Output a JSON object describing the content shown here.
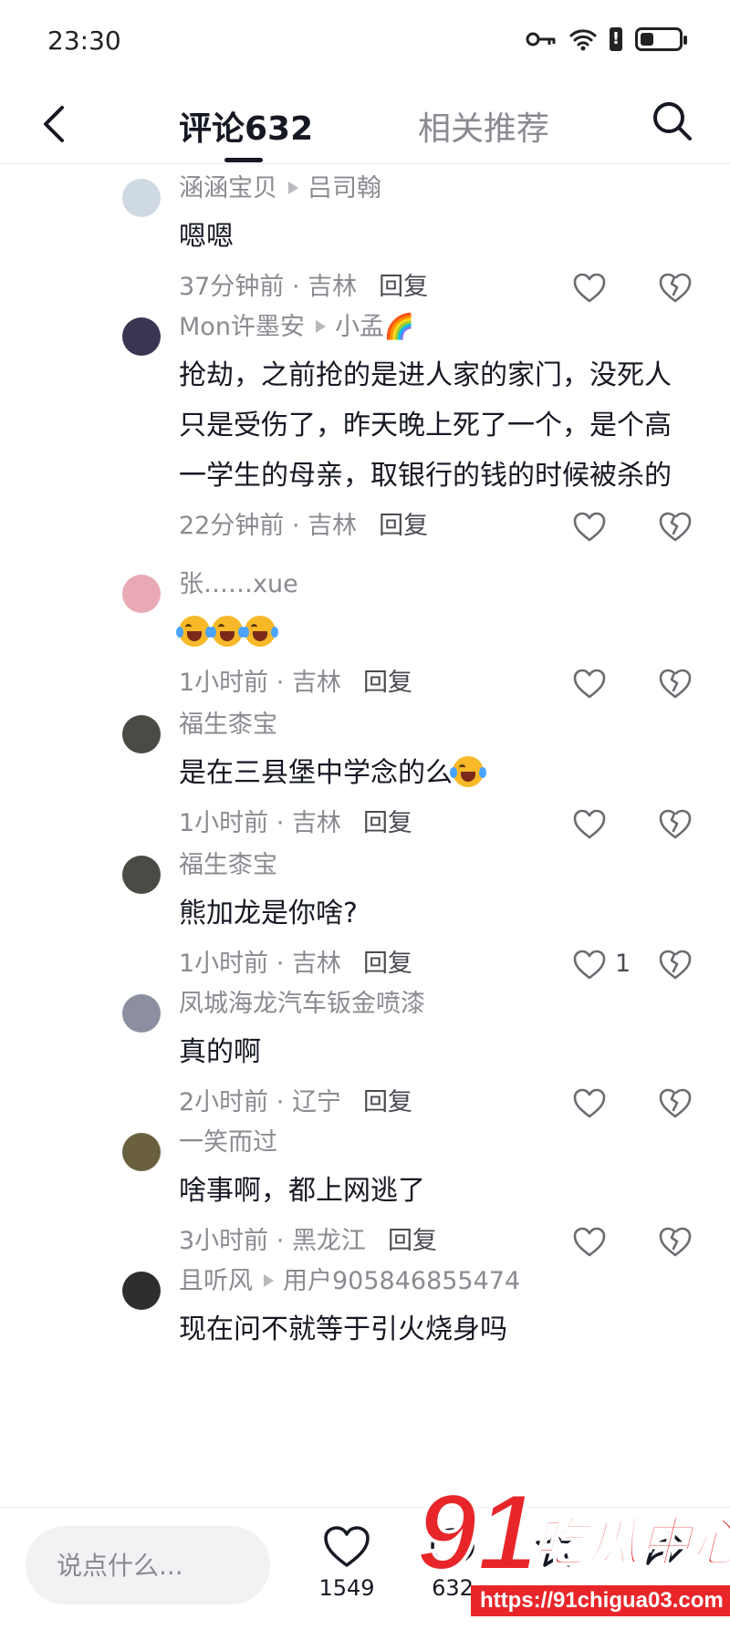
{
  "status_bar": {
    "time": "23:30",
    "battery_level_percent": 35
  },
  "header": {
    "tab_comments": "评论632",
    "tab_related": "相关推荐"
  },
  "comments": [
    {
      "author": "涵涵宝贝",
      "reply_to": "吕司翰",
      "text": "嗯嗯",
      "time": "37分钟前",
      "location": "吉林",
      "reply_label": "回复",
      "likes": "",
      "avatar_color": "#cfd9e3"
    },
    {
      "author": "Mon许墨安",
      "reply_to": "小孟🌈",
      "text": "抢劫，之前抢的是进人家的家门，没死人只是受伤了，昨天晚上死了一个，是个高一学生的母亲，取银行的钱的时候被杀的",
      "time": "22分钟前",
      "location": "吉林",
      "reply_label": "回复",
      "likes": "",
      "avatar_color": "#3a3550"
    },
    {
      "author": "张……xue",
      "reply_to": "",
      "text": "",
      "emoji": [
        "crying-laughing",
        "crying-laughing",
        "crying-laughing"
      ],
      "time": "1小时前",
      "location": "吉林",
      "reply_label": "回复",
      "likes": "",
      "avatar_color": "#e8a9b4"
    },
    {
      "author": "福生桼宝",
      "reply_to": "",
      "text": "是在三县堡中学念的么",
      "emoji": [
        "crying-laughing"
      ],
      "time": "1小时前",
      "location": "吉林",
      "reply_label": "回复",
      "likes": "",
      "avatar_color": "#4b4a44"
    },
    {
      "author": "福生桼宝",
      "reply_to": "",
      "text": "熊加龙是你啥?",
      "time": "1小时前",
      "location": "吉林",
      "reply_label": "回复",
      "likes": "1",
      "avatar_color": "#4b4a44"
    },
    {
      "author": "凤城海龙汽车钣金喷漆",
      "reply_to": "",
      "text": "真的啊",
      "time": "2小时前",
      "location": "辽宁",
      "reply_label": "回复",
      "likes": "",
      "avatar_color": "#8b8fa0"
    },
    {
      "author": "一笑而过",
      "reply_to": "",
      "text": "啥事啊，都上网逃了",
      "time": "3小时前",
      "location": "黑龙江",
      "reply_label": "回复",
      "likes": "",
      "avatar_color": "#6a6040"
    },
    {
      "author": "且听风",
      "reply_to": "用户905846855474",
      "text": "现在问不就等于引火烧身吗",
      "time": "",
      "location": "",
      "reply_label": "",
      "likes": "",
      "avatar_color": "#2e2e2e"
    }
  ],
  "bottom_bar": {
    "input_placeholder": "说点什么...",
    "like_count": "1549",
    "comment_count": "632"
  },
  "watermark": {
    "number": "91",
    "text": "吃瓜中心",
    "url": "https://91chigua03.com"
  },
  "colors": {
    "primary_text": "#161823",
    "secondary_text": "#8a8b91",
    "watermark_red": "#e8262a"
  }
}
